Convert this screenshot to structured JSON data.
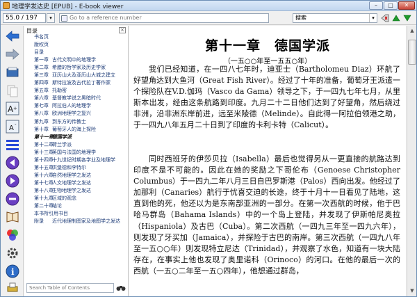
{
  "window": {
    "title": "地理学发达史 [EPUB] - E-book viewer",
    "min_label": "–",
    "max_label": "□",
    "close_label": "✕"
  },
  "toolbar": {
    "page_position": "55.0 / 197",
    "reference_placeholder": "Go to a reference number",
    "search_label": "搜索"
  },
  "toc": {
    "header": "目录",
    "close_label": "×",
    "items": [
      {
        "num": "",
        "text": "书名页"
      },
      {
        "num": "",
        "text": "版权页"
      },
      {
        "num": "",
        "text": "目录"
      },
      {
        "num": "第一章",
        "text": "古代文明中的地理学"
      },
      {
        "num": "第二章",
        "text": "希腊的哲学家及历史学家"
      },
      {
        "num": "第三章",
        "text": "亚历山大及亚历山大城之建立"
      },
      {
        "num": "第四章",
        "text": "斯特拉波及古代拉丁著作家"
      },
      {
        "num": "第五章",
        "text": "托勒密"
      },
      {
        "num": "第六章",
        "text": "基督教学说之黑暗时代"
      },
      {
        "num": "第七章",
        "text": "阿拉伯人的地理学"
      },
      {
        "num": "第八章",
        "text": "欧洲地理学之复兴"
      },
      {
        "num": "第九章",
        "text": "到东方的传教士"
      },
      {
        "num": "第十章",
        "text": "葡萄牙人的海上探险"
      },
      {
        "num": "第十一章",
        "text": "德国学派",
        "active": true
      },
      {
        "num": "第十二章",
        "text": "荷兰学派"
      },
      {
        "num": "第十三章",
        "text": "英国与法国的地理学"
      },
      {
        "num": "第十四章",
        "text": "十九世纪时期各学业及地理学"
      },
      {
        "num": "第十五章",
        "text": "洪堡德和李特尔"
      },
      {
        "num": "第十六章",
        "text": "自然地理学之发达"
      },
      {
        "num": "第十七章",
        "text": "人文地理学之发达"
      },
      {
        "num": "第十八章",
        "text": "生物地理学之发达"
      },
      {
        "num": "第十九章",
        "text": "区域的观念"
      },
      {
        "num": "第二十章",
        "text": "结论"
      },
      {
        "num": "",
        "text": "本书所引用书目"
      },
      {
        "num": "附录",
        "text": "近代地理制图家及地图学之发达"
      }
    ],
    "search_placeholder": "Search Table of Contents"
  },
  "content": {
    "chapter_title": "第十一章　德国学派",
    "subtitle": "（一五○○年至一五五○年）",
    "paragraphs": [
      "我们已经知道，在一四八七年时，迪亚士（Bartholomeu Diaz）环航了好望角达到大鱼河（Great Fish River）。经过了十年的准备，葡萄牙王派遣一个探险队在V.D.伽玛（Vasco da Gama）领导之下，于一四九七年七月，从里斯本出发，经由这条航路到印度。九月二十二日他们达到了好望角，然后绕过非洲，沿非洲东岸前进，远至米陵德（Melinde）。自此得一阿拉伯领港之助，于一四九八年五月二十日到了印度的卡利卡特（Calicut）。",
      "同时西班牙的伊莎贝拉（Isabella）最后也觉得另从一更直接的航路达到印度不是不可能的。因此在她的奖励之下哥伦布（Genoese Christopher Columbus）于一四九二年八月三日自巴罗斯港（Palos）西向出发。他经过了加那利（Canaries）航行于忧喜交迫的长途，终于十月十一日看见了陆地，这直到他的死，他还以为是东南部亚洲的一部分。在第一次西航的时候，他于巴哈马群岛（Bahama Islands）中的一个岛上登陆，并发现了伊斯帕尼奥拉（Hispaniola）及古巴（Cuba）。第二次西航（一四九三年至一四九六年），则发现了牙买加（Jamaica），并探险于古巴的南岸。第三次西航（一四九八年至一五○○年）则发现特立尼达（Trinidad），并观察了水色，知道有一块大陆存在，在事实上他也发现了奥里诺科（Orinoco）的河口。在他的最后一次的西航（一五○二年至一五○四年），他想通过群岛，"
    ]
  }
}
